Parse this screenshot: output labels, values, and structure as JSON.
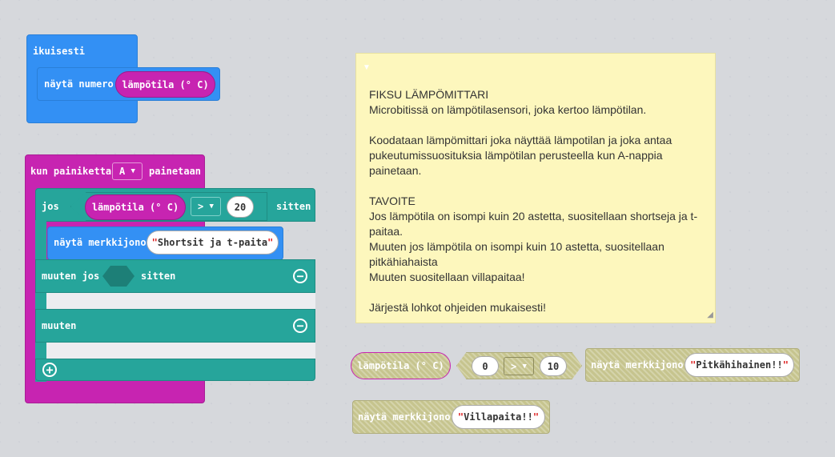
{
  "forever": {
    "label": "ikuisesti",
    "show_number": "näytä numero",
    "temperature": "lämpötila (° C)"
  },
  "button_event": {
    "prefix": "kun painiketta",
    "button": "A",
    "suffix": "painetaan"
  },
  "if_block": {
    "if_label": "jos",
    "temperature": "lämpötila (° C)",
    "operator": ">",
    "value": "20",
    "then_label": "sitten",
    "show_string": "näytä merkkijono",
    "string1": "Shortsit ja t-paita",
    "elseif_label": "muuten jos",
    "elseif_then": "sitten",
    "else_label": "muuten"
  },
  "note": {
    "lines": [
      "FIKSU LÄMPÖMITTARI",
      "Microbitissä on lämpötilasensori, joka kertoo lämpötilan.",
      "",
      "Koodataan lämpömittari joka näyttää lämpotilan ja joka antaa",
      "pukeutumissuosituksia lämpötilan perusteella kun A-nappia",
      "painetaan.",
      "",
      "TAVOITE",
      "Jos lämpötila on isompi kuin 20 astetta, suositellaan shortseja ja t-",
      "paitaa.",
      "Muuten jos lämpötila on isompi kuin 10 astetta, suositellaan",
      "pitkähiahaista",
      "Muuten suositellaan villapaitaa!",
      "",
      "Järjestä lohkot ohjeiden mukaisesti!"
    ]
  },
  "loose": {
    "temperature": "lämpötila (° C)",
    "compare_left": "0",
    "compare_op": ">",
    "compare_right": "10",
    "show_string1": "näytä merkkijono",
    "string1": "Pitkähihainen!!",
    "show_string2": "näytä merkkijono",
    "string2": "Villapaita!!"
  },
  "colors": {
    "basic": "#1e90ff",
    "input": "#c724b1",
    "logic": "#26a59b",
    "note": "#fdf7bd"
  }
}
